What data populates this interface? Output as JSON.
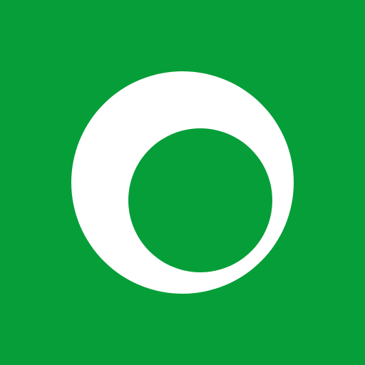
{
  "colors": {
    "background": "#069e38",
    "emblem": "#ffffff",
    "inner": "#069e38"
  },
  "icon": "ring-emblem-icon"
}
